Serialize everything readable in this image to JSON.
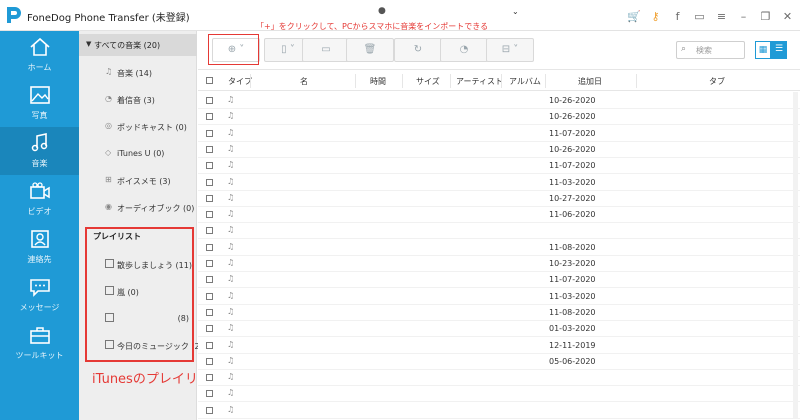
{
  "app": {
    "title": "FoneDog Phone Transfer (未登録)",
    "device_icon": "apple-icon",
    "device_caret": "⌄"
  },
  "hint": "「+」をクリックして、PCからスマホに音楽をインポートできる",
  "window_controls": [
    "cart-icon",
    "key-icon",
    "facebook-icon",
    "chat-icon",
    "menu-icon",
    "minimize-icon",
    "restore-icon",
    "close-icon"
  ],
  "nav": [
    {
      "label": "ホーム",
      "icon": "home-icon"
    },
    {
      "label": "写真",
      "icon": "photo-icon"
    },
    {
      "label": "音楽",
      "icon": "music-icon",
      "active": true
    },
    {
      "label": "ビデオ",
      "icon": "video-icon"
    },
    {
      "label": "連絡先",
      "icon": "contacts-icon"
    },
    {
      "label": "メッセージ",
      "icon": "message-icon"
    },
    {
      "label": "ツールキット",
      "icon": "toolkit-icon"
    }
  ],
  "categories": {
    "header": "すべての音楽 (20)",
    "items": [
      "音楽 (14)",
      "着信音 (3)",
      "ポッドキャスト (0)",
      "iTunes U (0)",
      "ボイスメモ (3)",
      "オーディオブック (0)"
    ]
  },
  "playlists": {
    "header": "プレイリスト",
    "items": [
      {
        "name": "散歩しましょう (11)",
        "count": ""
      },
      {
        "name": "嵐 (0)",
        "count": ""
      },
      {
        "name": "",
        "count": "(8)"
      },
      {
        "name": "今日のミュージック (2)",
        "count": ""
      }
    ],
    "caption": "iTunesのプレイリスト"
  },
  "toolbar": {
    "buttons": [
      "add-button",
      "export-button",
      "to-pc-button",
      "delete-button",
      "refresh-button",
      "ringtone-button",
      "toolbox-button"
    ],
    "search_placeholder": "検索"
  },
  "columns": [
    "タイプ",
    "名",
    "時間",
    "サイズ",
    "アーティスト",
    "アルバム",
    "追加日",
    "タブ"
  ],
  "rows": [
    "10-26-2020",
    "10-26-2020",
    "11-07-2020",
    "10-26-2020",
    "11-07-2020",
    "11-03-2020",
    "10-27-2020",
    "11-06-2020",
    "",
    "11-08-2020",
    "10-23-2020",
    "11-07-2020",
    "11-03-2020",
    "11-08-2020",
    "01-03-2020",
    "12-11-2019",
    "05-06-2020",
    "",
    "",
    ""
  ],
  "colors": {
    "accent": "#1f9ad6",
    "highlight": "#e53935"
  }
}
